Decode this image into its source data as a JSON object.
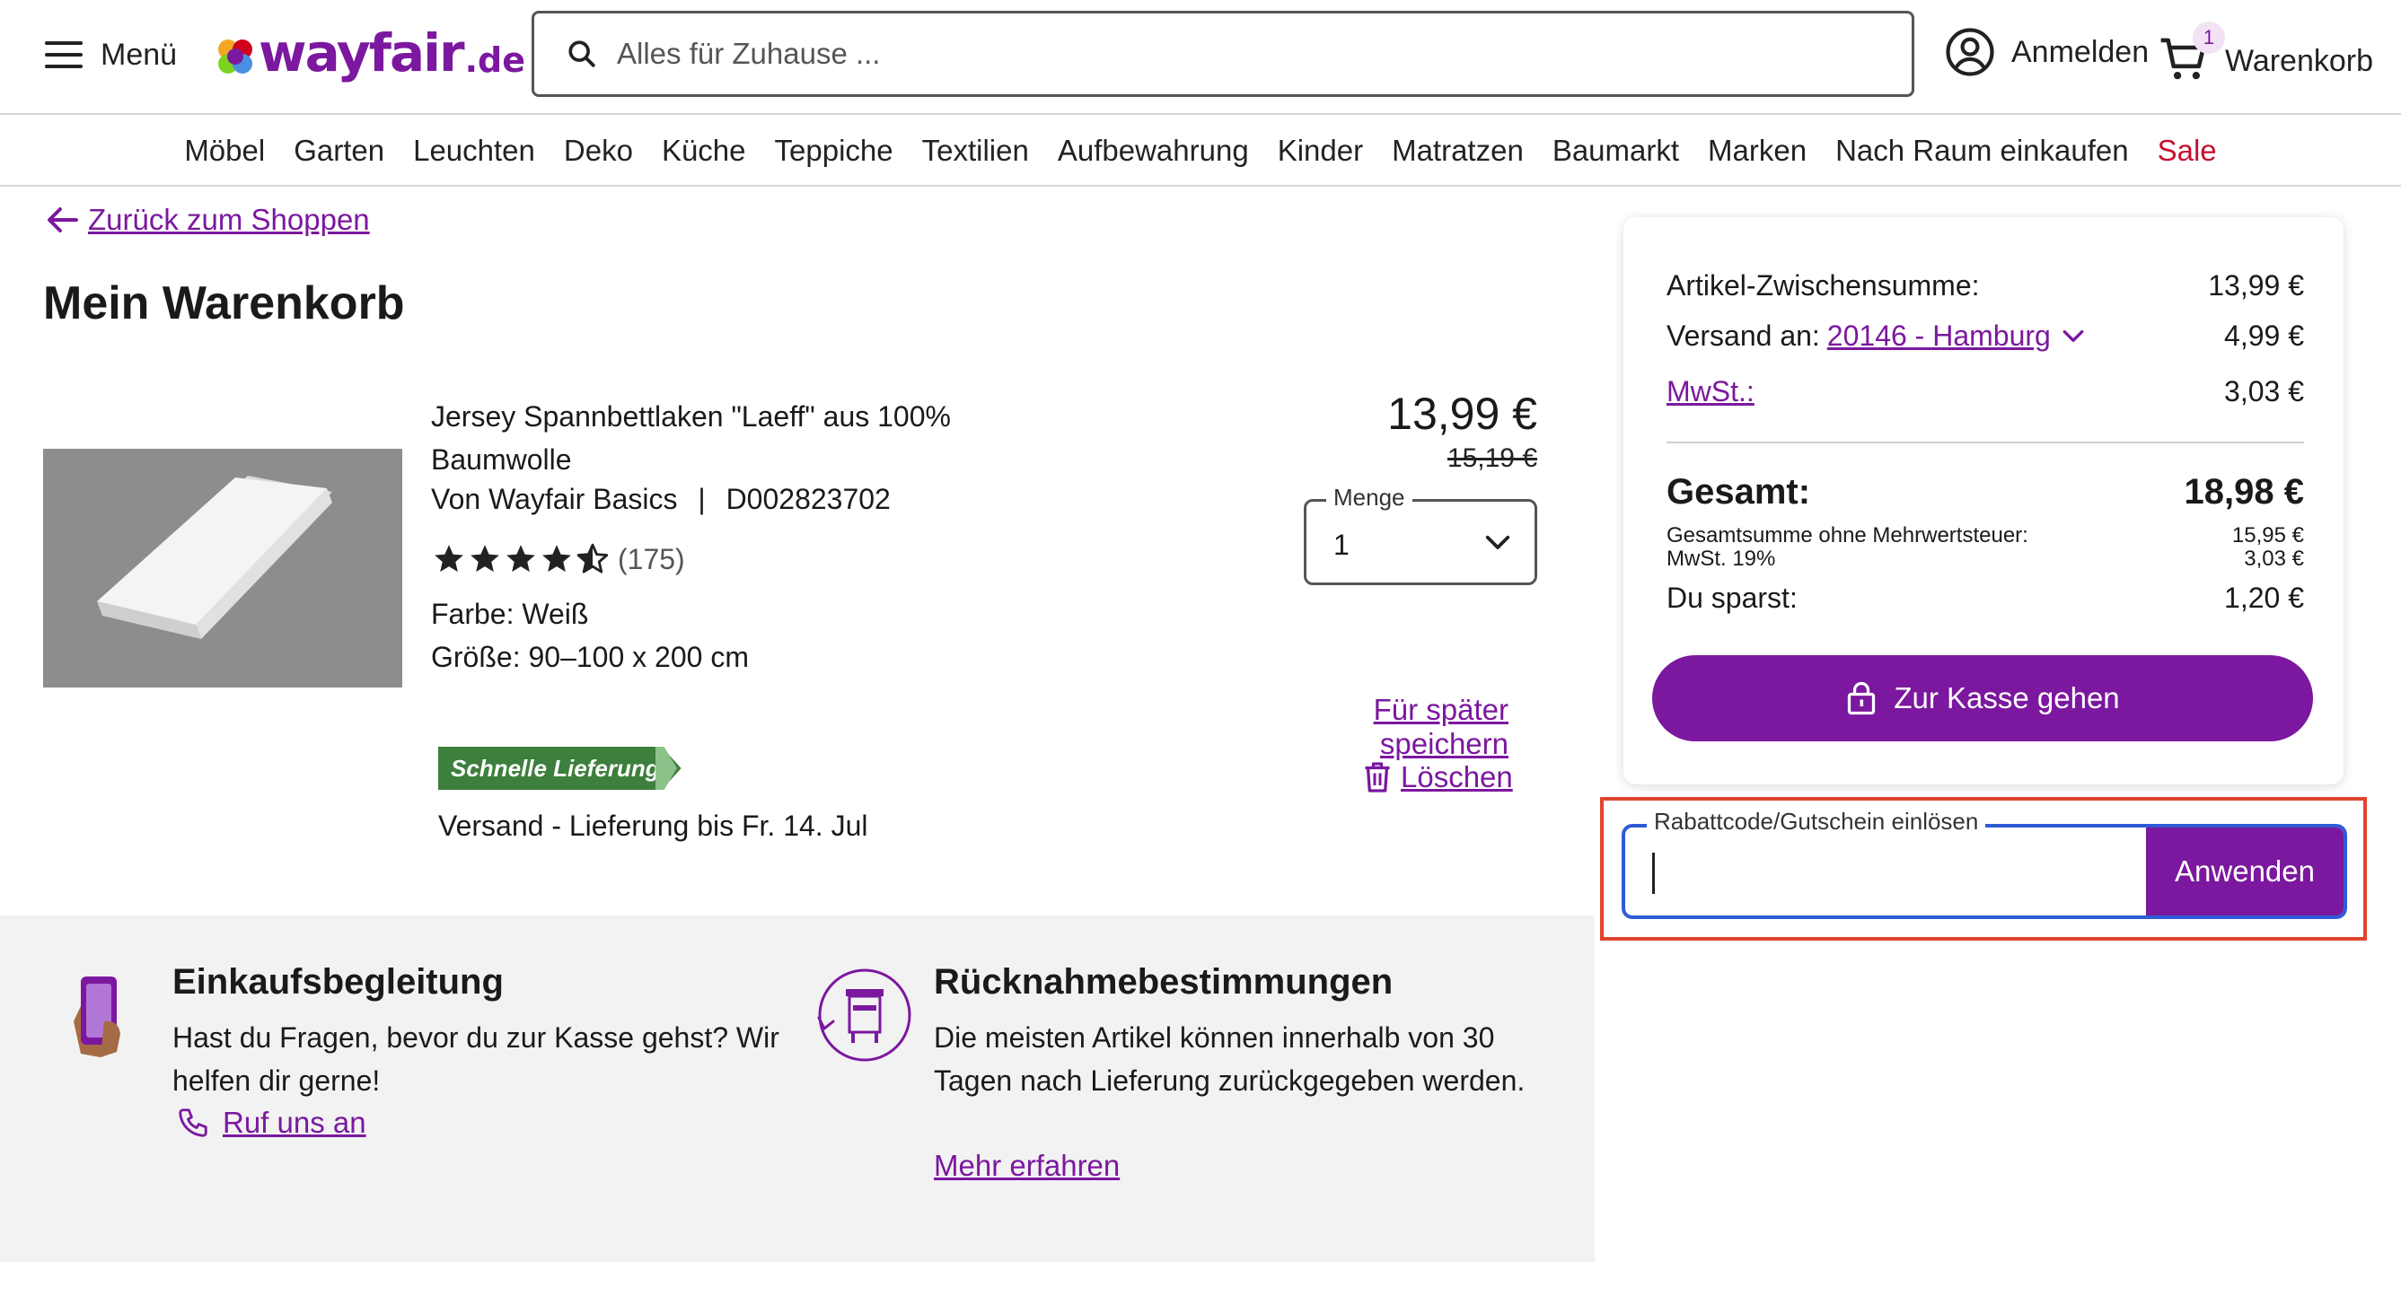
{
  "header": {
    "menu_label": "Menü",
    "logo_text": "wayfair",
    "logo_suffix": ".de",
    "search_placeholder": "Alles für Zuhause ...",
    "login_label": "Anmelden",
    "cart_label": "Warenkorb",
    "cart_count": "1"
  },
  "nav": {
    "items": [
      "Möbel",
      "Garten",
      "Leuchten",
      "Deko",
      "Küche",
      "Teppiche",
      "Textilien",
      "Aufbewahrung",
      "Kinder",
      "Matratzen",
      "Baumarkt",
      "Marken",
      "Nach Raum einkaufen"
    ],
    "sale": "Sale"
  },
  "page": {
    "back_link": "Zurück zum Shoppen",
    "title": "Mein Warenkorb"
  },
  "product": {
    "title": "Jersey Spannbettlaken \"Laeff\" aus 100% Baumwolle",
    "vendor": "Von Wayfair Basics",
    "separator": "|",
    "sku": "D002823702",
    "rating": 4.5,
    "review_count": "(175)",
    "color": "Farbe: Weiß",
    "size": "Größe: 90–100 x 200 cm",
    "badge": "Schnelle Lieferung",
    "shipping": "Versand - Lieferung bis Fr. 14. Jul",
    "price": "13,99 €",
    "old_price": "15,19 €",
    "qty_label": "Menge",
    "qty_value": "1",
    "save_later": "Für später speichern",
    "delete": "Löschen"
  },
  "info": {
    "help_title": "Einkaufsbegleitung",
    "help_text": "Hast du Fragen, bevor du zur Kasse gehst? Wir helfen dir gerne!",
    "help_link": "Ruf uns an",
    "return_title": "Rücknahmebestimmungen",
    "return_text": "Die meisten Artikel können innerhalb von 30 Tagen nach Lieferung zurückgegeben werden.",
    "return_link": "Mehr erfahren"
  },
  "summary": {
    "subtotal_label": "Artikel-Zwischensumme:",
    "subtotal_value": "13,99 €",
    "shipping_label": "Versand an:",
    "shipping_location": "20146 - Hamburg",
    "shipping_value": "4,99 €",
    "tax_label": "MwSt.:",
    "tax_value": "3,03 €",
    "total_label": "Gesamt:",
    "total_value": "18,98 €",
    "net_label": "Gesamtsumme ohne Mehrwertsteuer:",
    "net_value": "15,95 €",
    "vat_label": "MwSt. 19%",
    "vat_value": "3,03 €",
    "savings_label": "Du sparst:",
    "savings_value": "1,20 €",
    "checkout_label": "Zur Kasse gehen"
  },
  "coupon": {
    "label": "Rabattcode/Gutschein einlösen",
    "value": "",
    "apply_label": "Anwenden"
  },
  "colors": {
    "brand": "#7b189f",
    "sale": "#c8102e",
    "badge_green": "#3d7f3c",
    "focus_blue": "#2f5bd6",
    "highlight_red": "#e0442f"
  }
}
